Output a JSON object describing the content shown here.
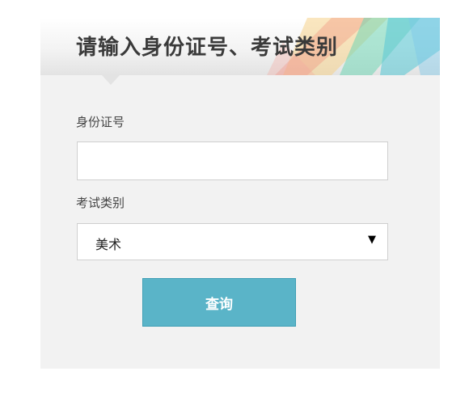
{
  "form": {
    "title": "请输入身份证号、考试类别",
    "id_label": "身份证号",
    "id_value": "",
    "id_placeholder": "",
    "category_label": "考试类别",
    "category_selected": "美术",
    "query_button_label": "查询"
  },
  "icons": {
    "select_arrow": "triangle-down-icon",
    "select_arrow_glyph": "▼"
  },
  "colors": {
    "button": "#5ab4c8",
    "card_background": "#f2f2f2",
    "title_text": "#3a3a3a"
  }
}
